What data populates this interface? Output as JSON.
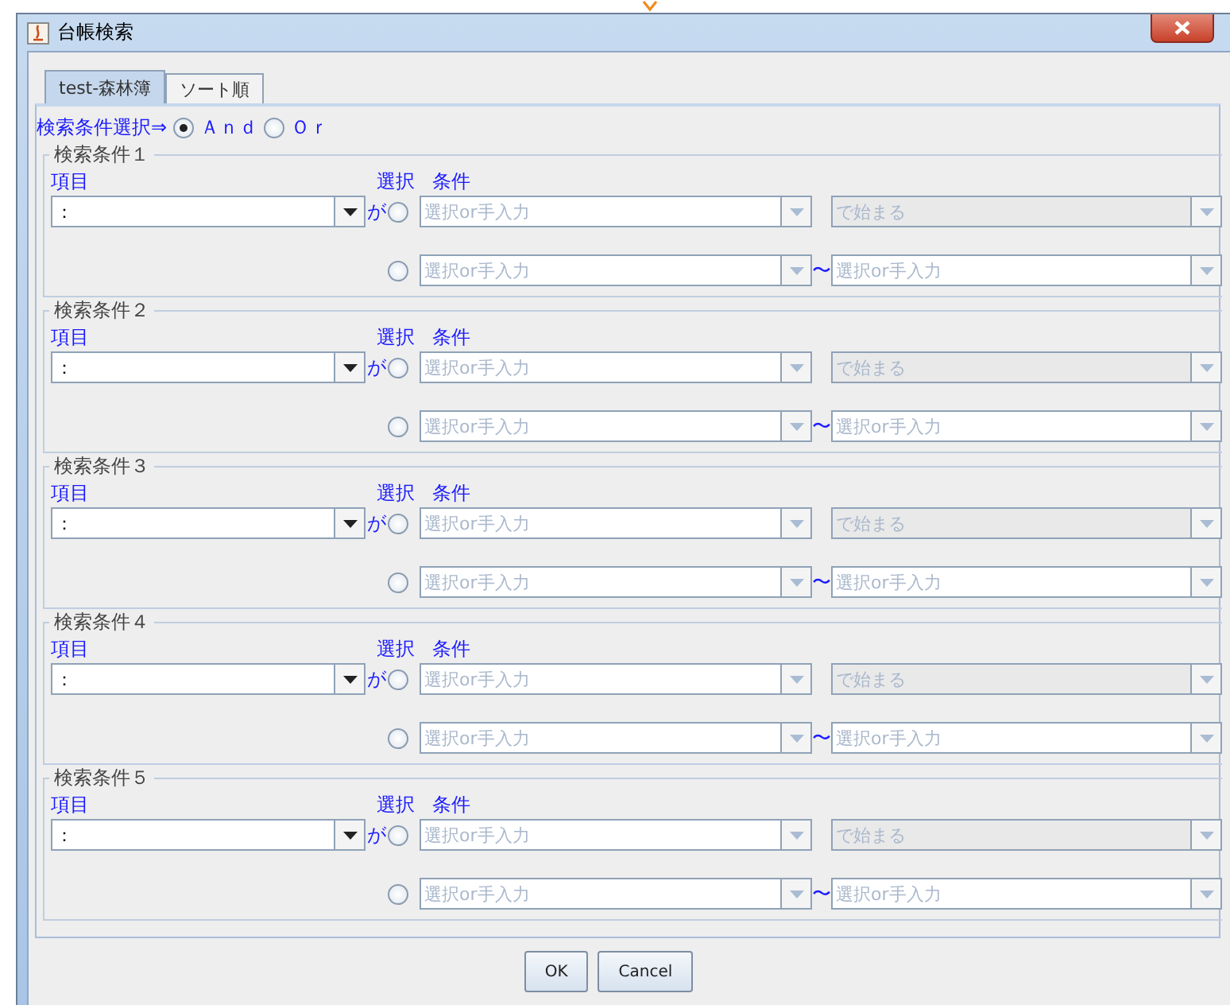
{
  "window": {
    "title": "台帳検索"
  },
  "tabs": [
    {
      "label": "test-森林簿",
      "selected": true
    },
    {
      "label": "ソート順",
      "selected": false
    }
  ],
  "match_mode": {
    "label": "検索条件選択⇒",
    "options": [
      {
        "label": "Ａｎｄ",
        "selected": true
      },
      {
        "label": "Ｏｒ",
        "selected": false
      }
    ]
  },
  "conditions": [
    {
      "title": "検索条件１",
      "item_label": "項目",
      "item_value": "：",
      "particle": "が",
      "select_label": "選択",
      "condition_label": "条件",
      "rows": [
        {
          "selected": false,
          "placeholder": "選択or手入力",
          "operator": {
            "value": "で始まる",
            "disabled": true
          }
        },
        {
          "selected": false,
          "placeholder": "選択or手入力",
          "separator": "〜",
          "to_placeholder": "選択or手入力"
        }
      ]
    },
    {
      "title": "検索条件２",
      "item_label": "項目",
      "item_value": "：",
      "particle": "が",
      "select_label": "選択",
      "condition_label": "条件",
      "rows": [
        {
          "selected": false,
          "placeholder": "選択or手入力",
          "operator": {
            "value": "で始まる",
            "disabled": true
          }
        },
        {
          "selected": false,
          "placeholder": "選択or手入力",
          "separator": "〜",
          "to_placeholder": "選択or手入力"
        }
      ]
    },
    {
      "title": "検索条件３",
      "item_label": "項目",
      "item_value": "：",
      "particle": "が",
      "select_label": "選択",
      "condition_label": "条件",
      "rows": [
        {
          "selected": false,
          "placeholder": "選択or手入力",
          "operator": {
            "value": "で始まる",
            "disabled": true
          }
        },
        {
          "selected": false,
          "placeholder": "選択or手入力",
          "separator": "〜",
          "to_placeholder": "選択or手入力"
        }
      ]
    },
    {
      "title": "検索条件４",
      "item_label": "項目",
      "item_value": "：",
      "particle": "が",
      "select_label": "選択",
      "condition_label": "条件",
      "rows": [
        {
          "selected": false,
          "placeholder": "選択or手入力",
          "operator": {
            "value": "で始まる",
            "disabled": true
          }
        },
        {
          "selected": false,
          "placeholder": "選択or手入力",
          "separator": "〜",
          "to_placeholder": "選択or手入力"
        }
      ]
    },
    {
      "title": "検索条件５",
      "item_label": "項目",
      "item_value": "：",
      "particle": "が",
      "select_label": "選択",
      "condition_label": "条件",
      "rows": [
        {
          "selected": false,
          "placeholder": "選択or手入力",
          "operator": {
            "value": "で始まる",
            "disabled": true
          }
        },
        {
          "selected": false,
          "placeholder": "選択or手入力",
          "separator": "〜",
          "to_placeholder": "選択or手入力"
        }
      ]
    }
  ],
  "buttons": [
    "OK",
    "Cancel"
  ]
}
